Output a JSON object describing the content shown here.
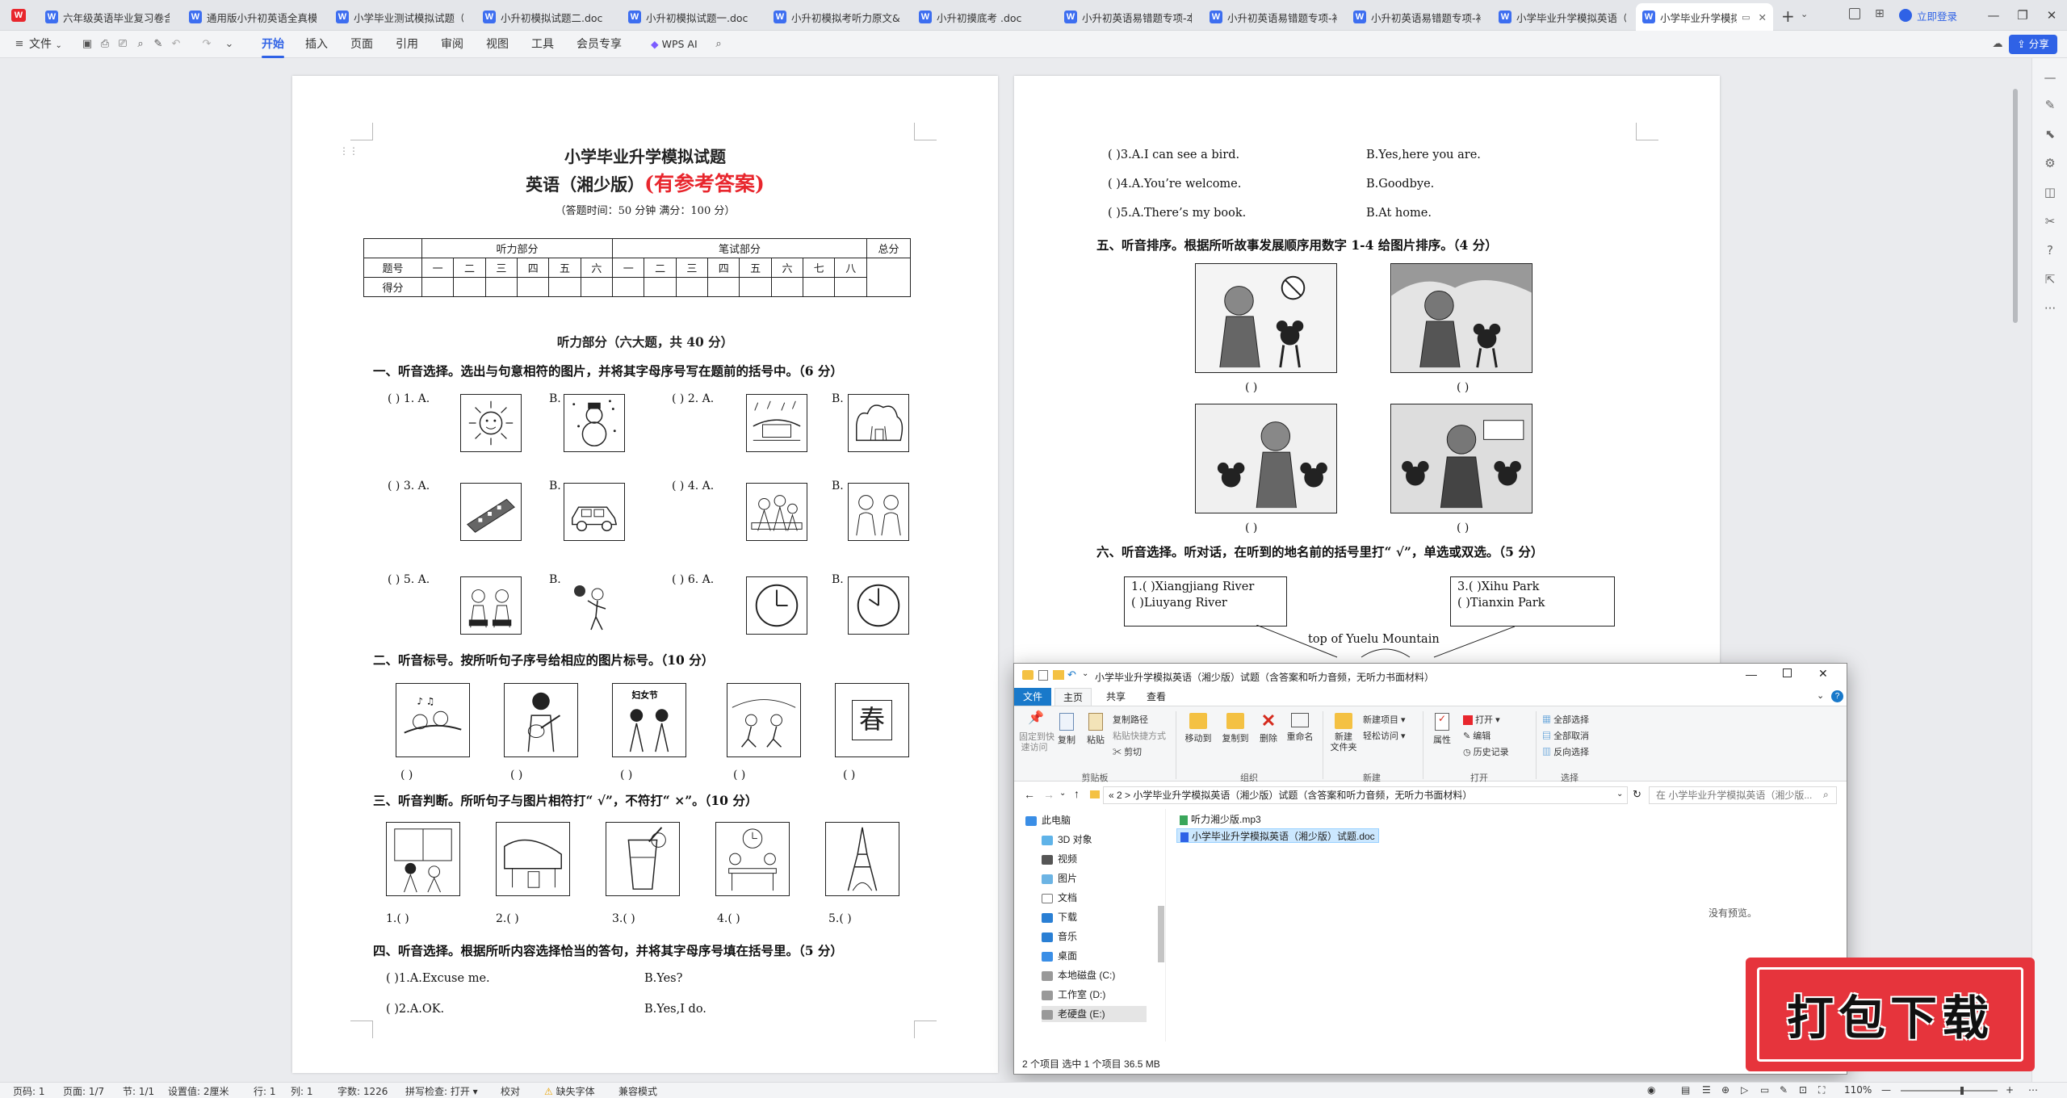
{
  "tabs": [
    {
      "label": "六年级英语毕业复习卷含答案"
    },
    {
      "label": "通用版小升初英语全真模拟"
    },
    {
      "label": "小学毕业测试模拟试题（"
    },
    {
      "label": "小升初模拟试题二.doc"
    },
    {
      "label": "小升初模拟试题一.doc"
    },
    {
      "label": "小升初模拟考听力原文&"
    },
    {
      "label": "小升初摸底考 .doc"
    },
    {
      "label": "小升初英语易错题专项-本"
    },
    {
      "label": "小升初英语易错题专项-补"
    },
    {
      "label": "小升初英语易错题专项-补"
    },
    {
      "label": "小学毕业升学模拟英语（"
    },
    {
      "label": "小学毕业升学模拟"
    }
  ],
  "tab_new": "+",
  "login_label": "立即登录",
  "menu": {
    "file": "文件",
    "items": [
      "开始",
      "插入",
      "页面",
      "引用",
      "审阅",
      "视图",
      "工具",
      "会员专享"
    ],
    "wps_ai": "WPS AI",
    "share": "分享"
  },
  "page1": {
    "title": "小学毕业升学模拟试题",
    "subtitle": "英语（湘少版）",
    "subtitle_red": "(有参考答案)",
    "time_note": "（答题时间：50 分钟    满分：100 分）",
    "table": {
      "listening": "听力部分",
      "writing": "笔试部分",
      "total": "总分",
      "row_label": "题号",
      "score_label": "得分",
      "listening_nums": [
        "一",
        "二",
        "三",
        "四",
        "五",
        "六"
      ],
      "writing_nums": [
        "一",
        "二",
        "三",
        "四",
        "五",
        "六",
        "七",
        "八"
      ]
    },
    "listen_header": "听力部分（六大题，共 40 分）",
    "sec1": "一、听音选择。选出与句意相符的图片，并将其字母序号写在题前的括号中。（6 分）",
    "sec1_items": [
      {
        "prefix": "(     ) 1. A.",
        "b": "B."
      },
      {
        "prefix": "(     ) 2. A.",
        "b": "B."
      },
      {
        "prefix": "(     ) 3. A.",
        "b": "B."
      },
      {
        "prefix": "(     ) 4. A.",
        "b": "B."
      },
      {
        "prefix": "(     ) 5. A.",
        "b": "B."
      },
      {
        "prefix": "(     ) 6. A.",
        "b": "B."
      }
    ],
    "sec2": "二、听音标号。按所听句子序号给相应的图片标号。（10 分）",
    "sec2_blanks": [
      "(          )",
      "(          )",
      "(          )",
      "(          )",
      "(          )"
    ],
    "sec2_sign": "妇女节",
    "sec2_char": "春",
    "sec3": "三、听音判断。所听句子与图片相符打“ √”，不符打“ ×”。（10 分）",
    "sec3_blanks": [
      "1.(          )",
      "2.(          )",
      "3.(          )",
      "4.(          )",
      "5.(          )"
    ],
    "sec4": "四、听音选择。根据所听内容选择恰当的答句，并将其字母序号填在括号里。（5 分）",
    "sec4_items": [
      {
        "a": "(          )1.A.Excuse me.",
        "b": "B.Yes?"
      },
      {
        "a": "(          )2.A.OK.",
        "b": "B.Yes,I do."
      }
    ]
  },
  "page2": {
    "sec4_cont": [
      {
        "a": "(          )3.A.I can see a bird.",
        "b": "B.Yes,here you are."
      },
      {
        "a": "(          )4.A.You’re welcome.",
        "b": "B.Goodbye."
      },
      {
        "a": "(          )5.A.There’s my book.",
        "b": "B.At home."
      }
    ],
    "sec5": "五、听音排序。根据所听故事发展顺序用数字 1-4 给图片排序。（4 分）",
    "sec5_blanks": [
      "(       )",
      "(       )",
      "(       )",
      "(       )"
    ],
    "sec6": "六、听音选择。听对话，在听到的地名前的括号里打“ √”，单选或双选。（5 分）",
    "box1": [
      "1.(      )Xiangjiang River",
      "   (      )Liuyang River"
    ],
    "box3": [
      "3.(      )Xihu Park",
      "   (      )Tianxin Park"
    ],
    "map_label": "top of Yuelu Mountain"
  },
  "explorer": {
    "title": "小学毕业升学模拟英语（湘少版）试题（含答案和听力音频，无听力书面材料）",
    "tabs": [
      "文件",
      "主页",
      "共享",
      "查看"
    ],
    "ribbon": {
      "pin": "固定到快\n速访问",
      "copy": "复制",
      "paste": "粘贴",
      "copy_path": "复制路径",
      "paste_shortcut": "粘贴快捷方式",
      "cut": "剪切",
      "clipboard": "剪贴板",
      "move_to": "移动到",
      "copy_to": "复制到",
      "delete": "删除",
      "rename": "重命名",
      "organize": "组织",
      "new_folder": "新建\n文件夹",
      "new_item": "新建项目",
      "easy_access": "轻松访问",
      "new": "新建",
      "properties": "属性",
      "open": "打开",
      "edit": "编辑",
      "history": "历史记录",
      "open_group": "打开",
      "select_all": "全部选择",
      "select_none": "全部取消",
      "invert": "反向选择",
      "select": "选择"
    },
    "address": "«  2  >  小学毕业升学模拟英语（湘少版）试题（含答案和听力音频，无听力书面材料）",
    "search_placeholder": "在 小学毕业升学模拟英语（湘少版...",
    "nav": [
      "此电脑",
      "3D 对象",
      "视频",
      "图片",
      "文档",
      "下载",
      "音乐",
      "桌面",
      "本地磁盘 (C:)",
      "工作室 (D:)",
      "老硬盘 (E:)"
    ],
    "files": [
      "听力湘少版.mp3",
      "小学毕业升学模拟英语（湘少版）试题.doc"
    ],
    "no_preview": "没有预览。",
    "status": "2 个项目    选中 1 个项目  36.5 MB"
  },
  "status": {
    "page": "页码: 1",
    "pages": "页面: 1/7",
    "section": "节: 1/1",
    "setting": "设置值: 2厘米",
    "row": "行: 1",
    "col": "列: 1",
    "words": "字数: 1226",
    "spell": "拼写检查: 打开 ▾",
    "proof": "校对",
    "missing_font": "缺失字体",
    "compat": "兼容模式",
    "zoom": "110%"
  },
  "download_banner": "打包下载",
  "colors": {
    "accent": "#2f62e6",
    "red": "#e8262d",
    "explorer_blue": "#1979ca"
  }
}
